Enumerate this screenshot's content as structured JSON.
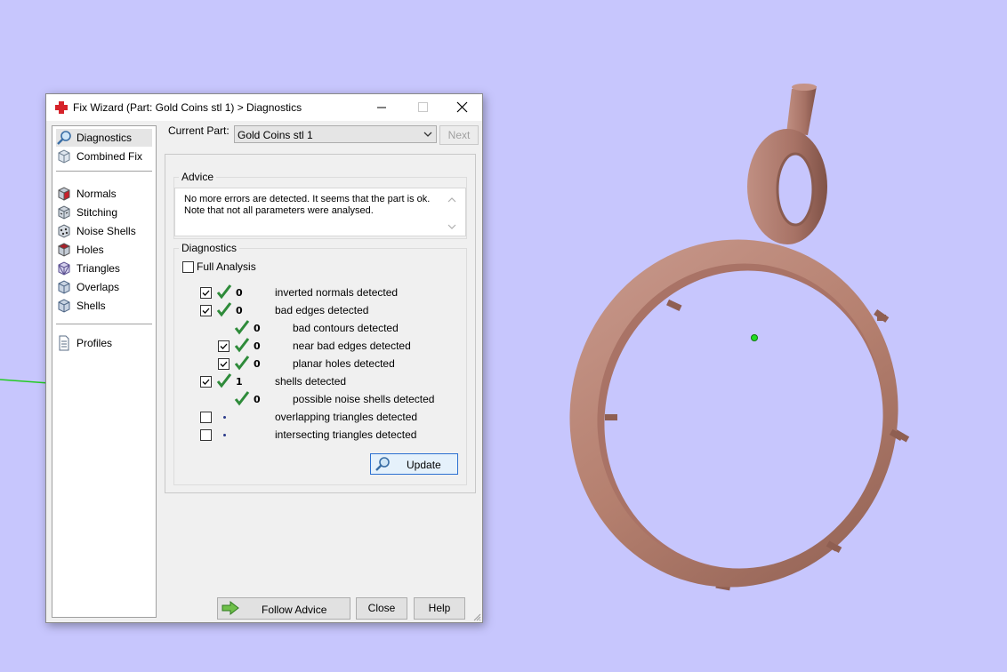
{
  "window": {
    "title": "Fix Wizard (Part: Gold Coins stl 1) > Diagnostics"
  },
  "sidebar": {
    "items": [
      {
        "label": "Diagnostics",
        "icon": "magnifier-icon",
        "selected": true
      },
      {
        "label": "Combined Fix",
        "icon": "cube-icon"
      },
      {
        "label": "Normals",
        "icon": "normals-cube-icon"
      },
      {
        "label": "Stitching",
        "icon": "stitching-cube-icon"
      },
      {
        "label": "Noise Shells",
        "icon": "noise-shells-cube-icon"
      },
      {
        "label": "Holes",
        "icon": "holes-cube-icon"
      },
      {
        "label": "Triangles",
        "icon": "triangles-cube-icon"
      },
      {
        "label": "Overlaps",
        "icon": "overlaps-cube-icon"
      },
      {
        "label": "Shells",
        "icon": "shells-cube-icon"
      },
      {
        "label": "Profiles",
        "icon": "document-icon"
      }
    ]
  },
  "current_part": {
    "label": "Current Part:",
    "value": "Gold Coins stl 1",
    "next_label": "Next"
  },
  "advice": {
    "title": "Advice",
    "line1": "No more errors are detected. It seems that the part is ok.",
    "line2": "Note that not all parameters were analysed."
  },
  "diagnostics": {
    "title": "Diagnostics",
    "full_analysis_label": "Full Analysis",
    "full_analysis_checked": false,
    "rows": [
      {
        "checked": true,
        "status": "ok",
        "count": "0",
        "label": "inverted normals detected"
      },
      {
        "checked": true,
        "status": "ok",
        "count": "0",
        "label": "bad edges detected"
      },
      {
        "status": "ok",
        "count": "0",
        "label": "bad contours detected"
      },
      {
        "checked": true,
        "status": "ok",
        "count": "0",
        "label": "near bad edges detected"
      },
      {
        "checked": true,
        "status": "ok",
        "count": "0",
        "label": "planar holes detected"
      },
      {
        "checked": true,
        "status": "ok",
        "count": "1",
        "label": "shells detected"
      },
      {
        "status": "ok",
        "count": "0",
        "label": "possible noise shells detected"
      },
      {
        "checked": false,
        "status": "not-analysed",
        "label": "overlapping triangles detected"
      },
      {
        "checked": false,
        "status": "not-analysed",
        "label": "intersecting triangles detected"
      }
    ],
    "update_label": "Update"
  },
  "footer": {
    "follow_advice_label": "Follow Advice",
    "close_label": "Close",
    "help_label": "Help"
  },
  "colors": {
    "viewport_background": "#c7c6fd",
    "model_color": "#b98478",
    "check_green": "#2e8b3a",
    "axis_green": "#22cc22"
  }
}
